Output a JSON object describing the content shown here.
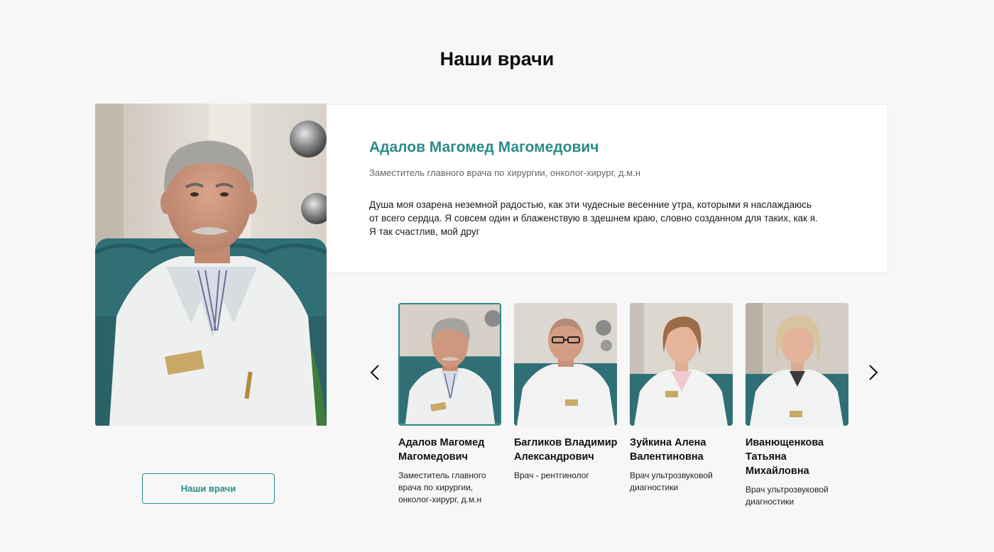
{
  "section": {
    "title": "Наши врачи"
  },
  "featured": {
    "name": "Адалов Магомед Магомедович",
    "position": "Заместитель главного врача по хирургии, онколог-хирург, д.м.н",
    "bio": "Душа моя озарена неземной радостью, как эти чудесные весенние утра, которыми я наслаждаюсь от всего сердца. Я совсем один и блаженствую в здешнем краю, словно созданном для таких, как я. Я так счастлив, мой друг"
  },
  "doctors_button": {
    "label": "Наши врачи"
  },
  "carousel": {
    "prev_icon": "chevron-left-icon",
    "next_icon": "chevron-right-icon",
    "cards": [
      {
        "name": "Адалов Магомед Магомедович",
        "position": "Заместитель главного врача по хирургии, онколог-хирург, д.м.н",
        "active": true
      },
      {
        "name": "Багликов Владимир Александрович",
        "position": "Врач - рентгинолог",
        "active": false
      },
      {
        "name": "Зуйкина Алена Валентиновна",
        "position": "Врач ультрозвуковой диагностики",
        "active": false
      },
      {
        "name": "Иванющенкова Татьяна Михайловна",
        "position": "Врач ультрозвуковой диагностики",
        "active": false
      }
    ]
  },
  "colors": {
    "accent": "#2c8a8a",
    "background": "#f7f7f7",
    "card": "#ffffff",
    "upholstery": "#2f6f75"
  }
}
